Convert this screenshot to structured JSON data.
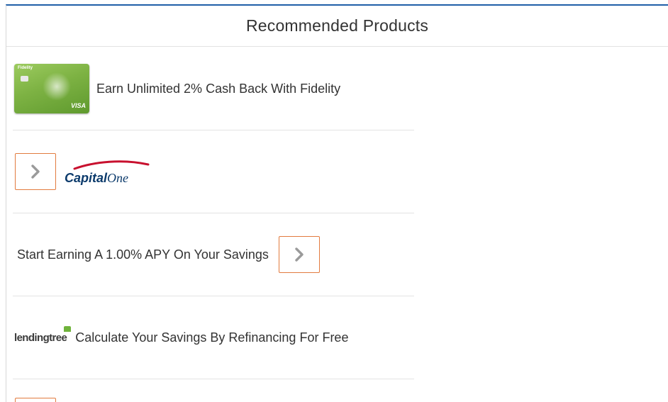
{
  "widget": {
    "title": "Recommended Products"
  },
  "items": [
    {
      "label": "Earn Unlimited 2% Cash Back With Fidelity",
      "thumb": {
        "brand": "Fidelity",
        "network": "VISA"
      }
    },
    {
      "logo": {
        "part_a": "Capital",
        "part_b": "One"
      },
      "button_icon": "chevron-right-icon"
    },
    {
      "label": "Start Earning A 1.00% APY On Your Savings",
      "button_icon": "chevron-right-icon"
    },
    {
      "label": "Calculate Your Savings By Refinancing For Free",
      "logo": {
        "text": "lendingtree"
      }
    }
  ],
  "colors": {
    "accent_top_border": "#1f5fa8",
    "button_border": "#e27b3f",
    "chevron": "#9a9a9a",
    "capital_one_navy": "#0b3a6b",
    "capital_one_red": "#c8102e",
    "lendingtree_green": "#6fb33b"
  }
}
